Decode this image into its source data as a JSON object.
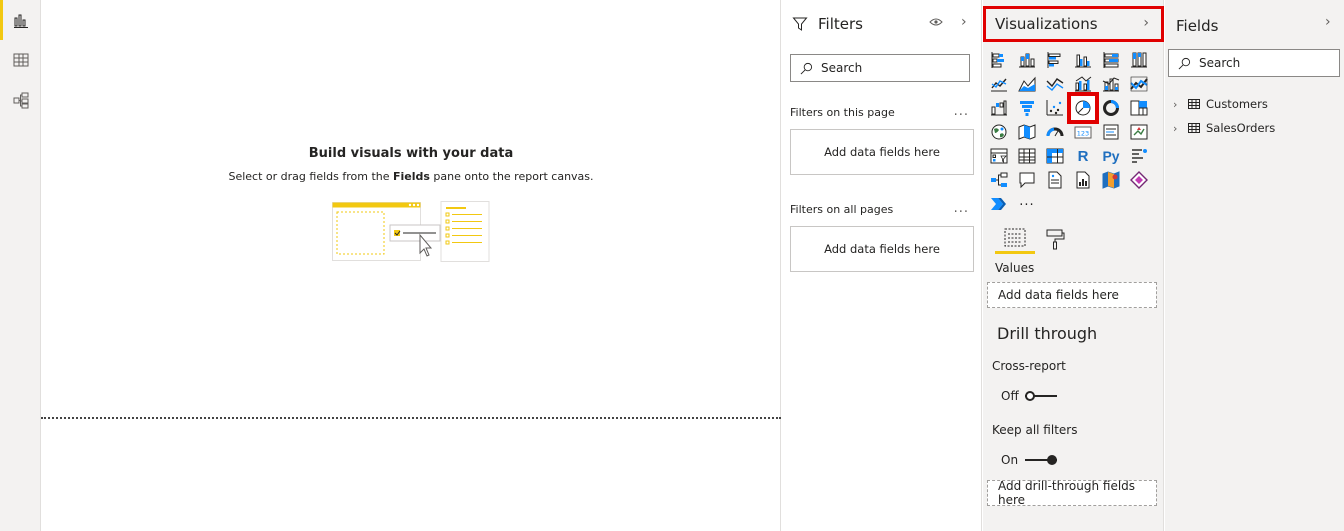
{
  "rail": {
    "items": [
      {
        "name": "report-view",
        "icon": "bar-chart-icon",
        "active": true
      },
      {
        "name": "data-view",
        "icon": "table-icon",
        "active": false
      },
      {
        "name": "model-view",
        "icon": "model-icon",
        "active": false
      }
    ]
  },
  "canvas": {
    "empty_title": "Build visuals with your data",
    "empty_desc_pre": "Select or drag fields from the ",
    "empty_desc_bold": "Fields",
    "empty_desc_post": " pane onto the report canvas."
  },
  "filters": {
    "title": "Filters",
    "search_placeholder": "Search",
    "on_page_label": "Filters on this page",
    "on_page_well": "Add data fields here",
    "all_pages_label": "Filters on all pages",
    "all_pages_well": "Add data fields here",
    "more": "..."
  },
  "visualizations": {
    "title": "Visualizations",
    "selected_icon": "pie-chart-icon",
    "icons": [
      "stacked-bar-icon",
      "stacked-column-icon",
      "clustered-bar-icon",
      "clustered-column-icon",
      "100-stacked-bar-icon",
      "100-stacked-column-icon",
      "line-chart-icon",
      "area-chart-icon",
      "stacked-area-icon",
      "line-clustered-column-icon",
      "line-stacked-column-icon",
      "ribbon-chart-icon",
      "waterfall-icon",
      "funnel-icon",
      "scatter-icon",
      "pie-chart-icon",
      "donut-icon",
      "treemap-icon",
      "map-icon",
      "filled-map-icon",
      "gauge-icon",
      "card-icon",
      "multi-row-card-icon",
      "kpi-icon",
      "slicer-icon",
      "table-icon",
      "matrix-icon",
      "r-visual-icon",
      "python-visual-icon",
      "key-influencers-icon",
      "decomposition-tree-icon",
      "qa-icon",
      "smart-narrative-icon",
      "paginated-report-icon",
      "arcgis-map-icon",
      "power-apps-icon",
      "power-automate-icon",
      "more-visuals-icon"
    ],
    "text_r": "R",
    "text_py": "Py",
    "text_more": "...",
    "values_label": "Values",
    "values_well": "Add data fields here",
    "drill_title": "Drill through",
    "cross_report_label": "Cross-report",
    "cross_report_state": "Off",
    "keep_filters_label": "Keep all filters",
    "keep_filters_state": "On",
    "drill_well": "Add drill-through fields here"
  },
  "fields": {
    "title": "Fields",
    "search_placeholder": "Search",
    "tables": [
      "Customers",
      "SalesOrders"
    ]
  },
  "colors": {
    "accent": "#f2c811",
    "highlight": "#e00000",
    "pane_bg": "#f3f2f1"
  }
}
